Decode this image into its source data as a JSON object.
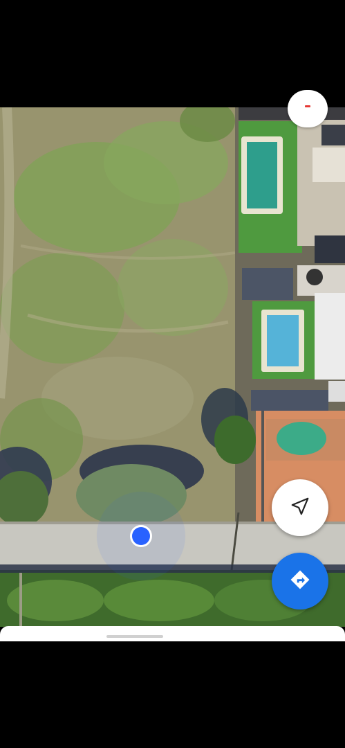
{
  "map": {
    "type": "satellite",
    "content": "aerial view"
  },
  "controls": {
    "compass_icon": "compass-icon",
    "my_location_icon": "navigation-arrow-icon",
    "directions_icon": "directions-icon"
  },
  "colors": {
    "location_dot": "#2962ff",
    "directions_button": "#1a73e8",
    "compass_needle": "#e53935"
  }
}
